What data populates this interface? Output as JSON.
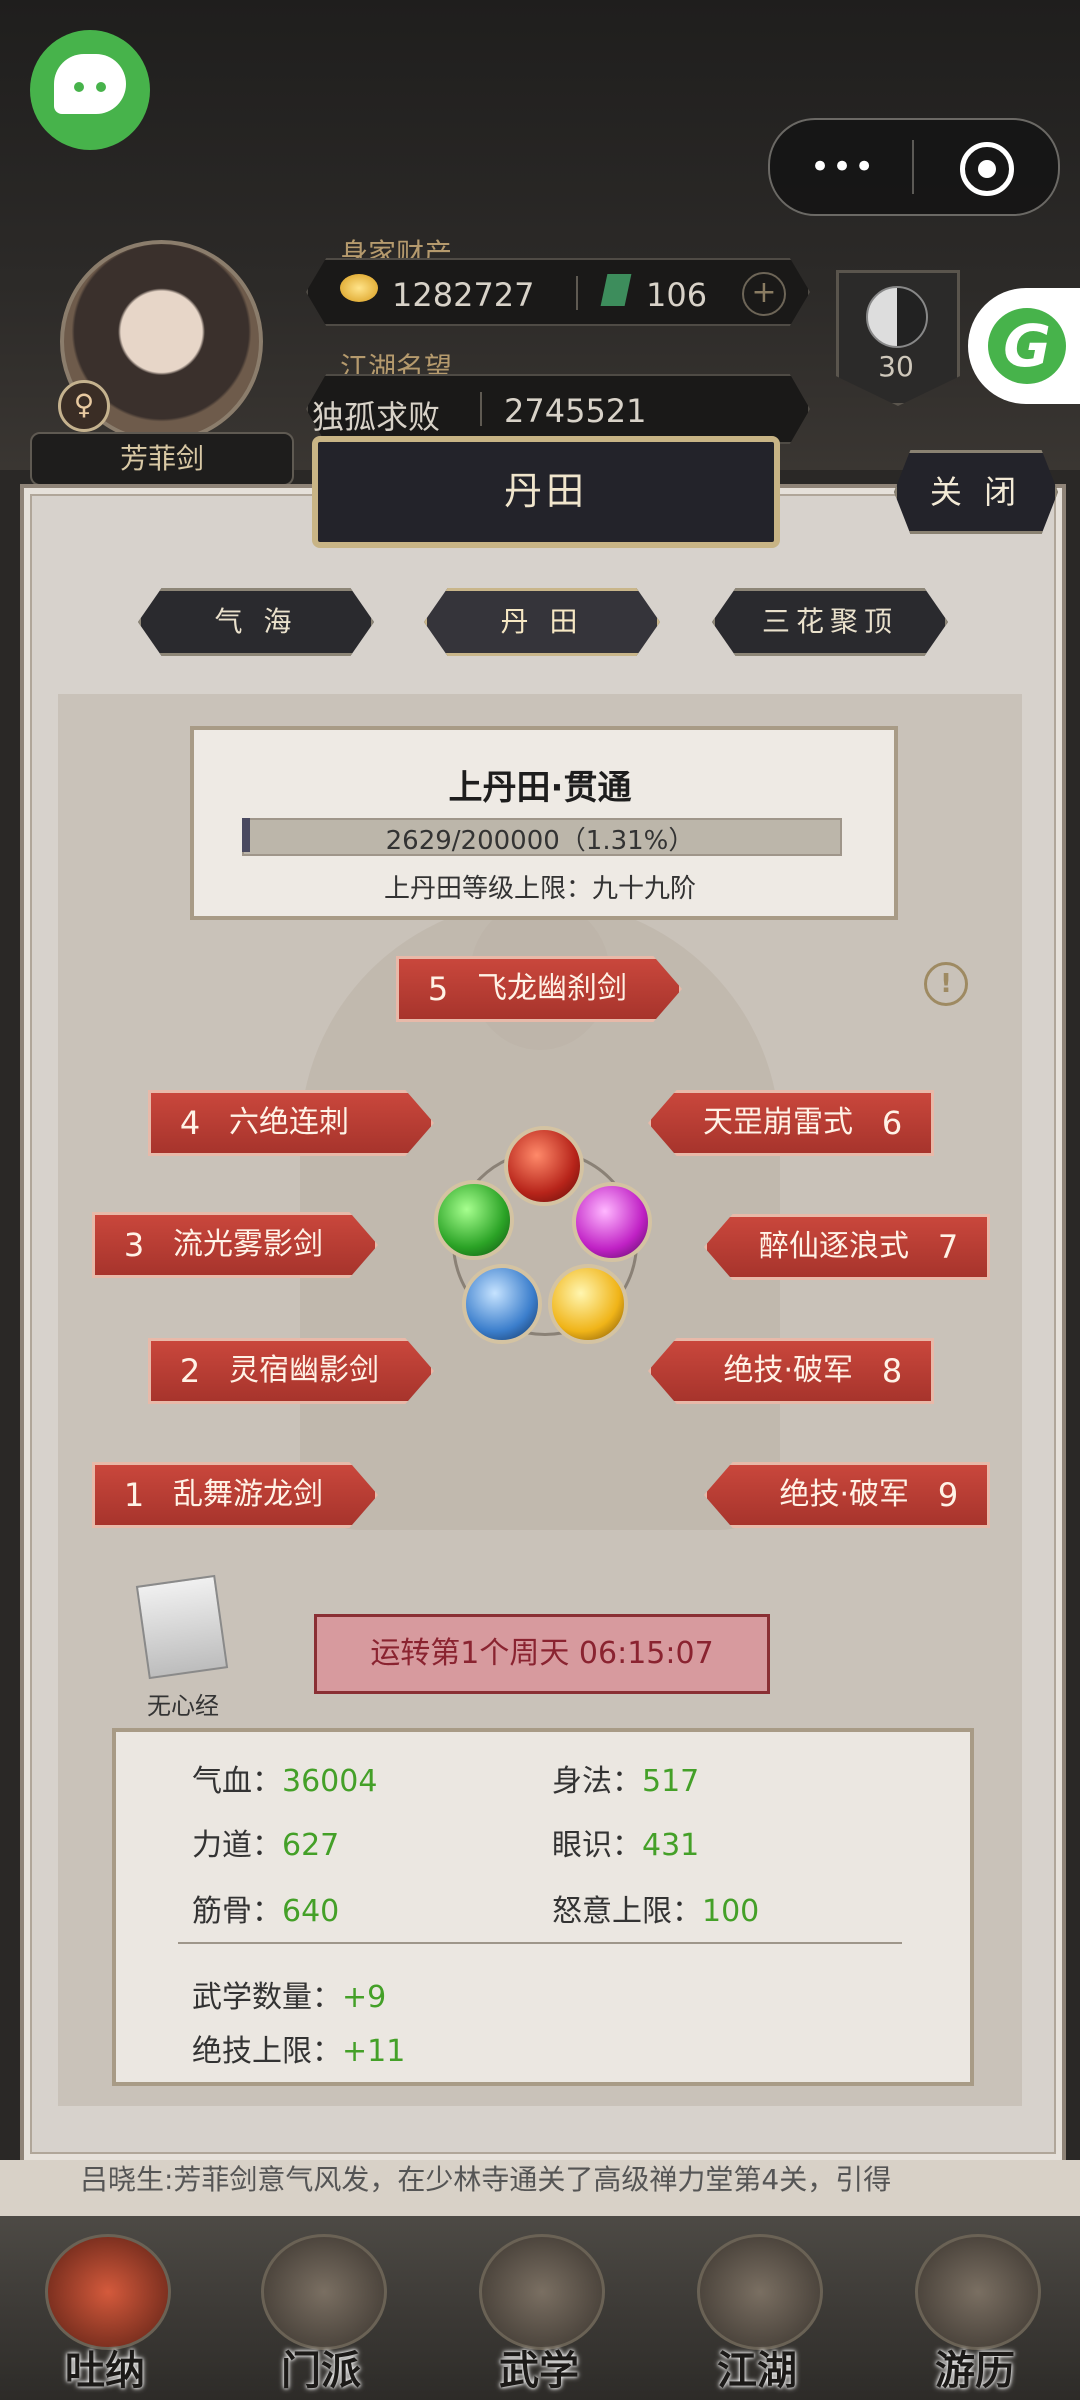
{
  "header": {
    "player_name": "芳菲剑",
    "gender_symbol": "♀",
    "wealth_label": "身家财产",
    "gold": "1282727",
    "jade": "106",
    "plus": "+",
    "fame_label": "江湖名望",
    "fame_title": "独孤求败",
    "fame_value": "2745521",
    "level": "30"
  },
  "miniprogram": {
    "menu_dots": "•••"
  },
  "modal": {
    "title": "丹田",
    "close_label": "关 闭",
    "tabs": [
      {
        "label": "气 海",
        "active": false
      },
      {
        "label": "丹 田",
        "active": true
      },
      {
        "label": "三花聚顶",
        "active": false
      }
    ],
    "realm": {
      "title": "上丹田·贯通",
      "progress_text": "2629/200000（1.31%）",
      "progress_fraction": 0.0131,
      "cap_text": "上丹田等级上限：九十九阶"
    },
    "alert_symbol": "!",
    "skills": [
      {
        "num": "1",
        "name": "乱舞游龙剑"
      },
      {
        "num": "2",
        "name": "灵宿幽影剑"
      },
      {
        "num": "3",
        "name": "流光雾影剑"
      },
      {
        "num": "4",
        "name": "六绝连刺"
      },
      {
        "num": "5",
        "name": "飞龙幽刹剑"
      },
      {
        "num": "6",
        "name": "天罡崩雷式"
      },
      {
        "num": "7",
        "name": "醉仙逐浪式"
      },
      {
        "num": "8",
        "name": "绝技·破军"
      },
      {
        "num": "9",
        "name": "绝技·破军"
      }
    ],
    "book_label": "无心经",
    "timer_text": "运转第1个周天 06:15:07",
    "stats": {
      "hp_label": "气血：",
      "hp": "36004",
      "agility_label": "身法：",
      "agility": "517",
      "strength_label": "力道：",
      "strength": "627",
      "insight_label": "眼识：",
      "insight": "431",
      "bone_label": "筋骨：",
      "bone": "640",
      "rage_label": "怒意上限：",
      "rage": "100",
      "martial_label": "武学数量：",
      "martial": "+9",
      "ult_label": "绝技上限：",
      "ult": "+11"
    }
  },
  "log_text": "吕晓生:芳菲剑意气风发，在少林寺通关了高级禅力堂第4关，引得",
  "nav": [
    {
      "label": "吐纳",
      "active": true
    },
    {
      "label": "门派",
      "active": false
    },
    {
      "label": "武学",
      "active": false
    },
    {
      "label": "江湖",
      "active": false
    },
    {
      "label": "游历",
      "active": false
    }
  ],
  "colors": {
    "accent_red": "#c9473c",
    "stat_green": "#44a028",
    "wechat_green": "#47b34b"
  }
}
